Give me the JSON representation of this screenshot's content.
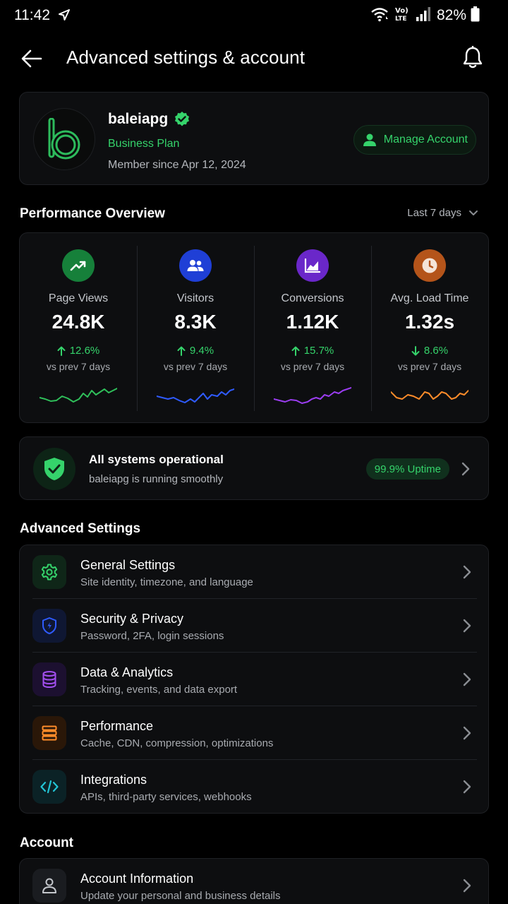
{
  "status_bar": {
    "time": "11:42",
    "battery_pct": "82%"
  },
  "header": {
    "title": "Advanced settings & account"
  },
  "profile": {
    "avatar_letter": "b",
    "name": "baleiapg",
    "plan": "Business Plan",
    "member_since": "Member since Apr 12, 2024",
    "manage_label": "Manage Account"
  },
  "performance": {
    "title": "Performance Overview",
    "range": "Last 7 days",
    "metrics": [
      {
        "label": "Page Views",
        "value": "24.8K",
        "delta": "12.6%",
        "direction": "up",
        "compare": "vs prev 7 days",
        "color": "#2fbf5a",
        "icon_bg": "#16803a",
        "icon": "trending-up-icon"
      },
      {
        "label": "Visitors",
        "value": "8.3K",
        "delta": "9.4%",
        "direction": "up",
        "compare": "vs prev 7 days",
        "color": "#2f5bff",
        "icon_bg": "#1f3fd6",
        "icon": "users-icon"
      },
      {
        "label": "Conversions",
        "value": "1.12K",
        "delta": "15.7%",
        "direction": "up",
        "compare": "vs prev 7 days",
        "color": "#9a3df0",
        "icon_bg": "#6a27c9",
        "icon": "chart-area-icon"
      },
      {
        "label": "Avg. Load Time",
        "value": "1.32s",
        "delta": "8.6%",
        "direction": "down",
        "compare": "vs prev 7 days",
        "color": "#ff8c2a",
        "icon_bg": "#b4541a",
        "icon": "clock-icon"
      }
    ]
  },
  "system_status": {
    "title": "All systems operational",
    "subtitle": "baleiapg is running smoothly",
    "uptime": "99.9% Uptime"
  },
  "advanced_settings": {
    "title": "Advanced Settings",
    "items": [
      {
        "title": "General Settings",
        "subtitle": "Site identity, timezone, and language",
        "icon": "gear-icon",
        "color": "#35d36b",
        "bg": "#0f2618"
      },
      {
        "title": "Security & Privacy",
        "subtitle": "Password, 2FA, login sessions",
        "icon": "shield-icon",
        "color": "#2f5bff",
        "bg": "#0f1733"
      },
      {
        "title": "Data & Analytics",
        "subtitle": "Tracking, events, and data export",
        "icon": "database-icon",
        "color": "#a34ff0",
        "bg": "#1c1030"
      },
      {
        "title": "Performance",
        "subtitle": "Cache, CDN, compression, optimizations",
        "icon": "server-icon",
        "color": "#ff8c2a",
        "bg": "#2a1708"
      },
      {
        "title": "Integrations",
        "subtitle": "APIs, third-party services, webhooks",
        "icon": "code-icon",
        "color": "#22c4d4",
        "bg": "#0b2226"
      }
    ]
  },
  "account": {
    "title": "Account",
    "items": [
      {
        "title": "Account Information",
        "subtitle": "Update your personal and business details",
        "icon": "user-icon"
      }
    ]
  }
}
